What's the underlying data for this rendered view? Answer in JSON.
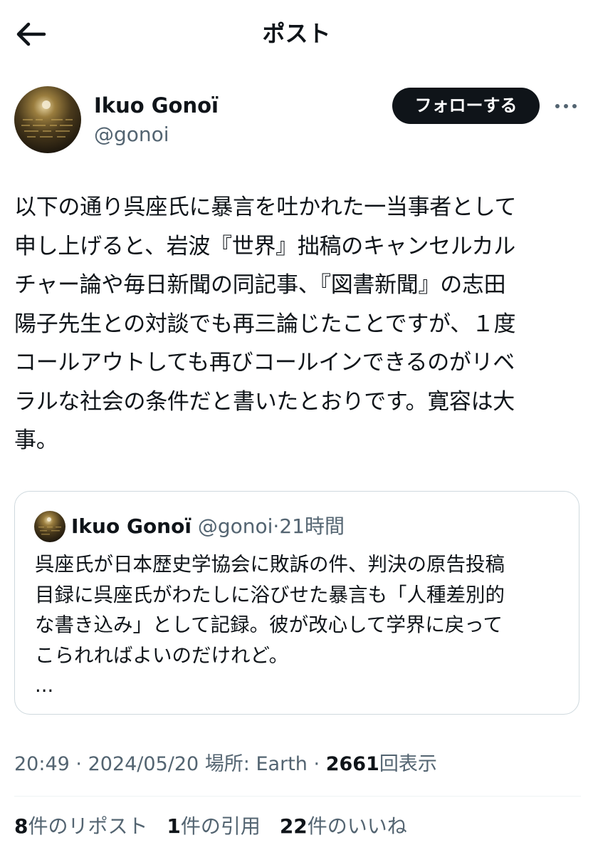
{
  "header": {
    "title": "ポスト",
    "back_icon": "arrow-left-icon"
  },
  "author": {
    "display_name": "Ikuo Gonoï",
    "handle": "@gonoi",
    "follow_label": "フォローする",
    "more_icon": "more-horizontal-icon"
  },
  "post": {
    "lines": [
      "以下の通り呉座氏に暴言を吐かれた一当事者として",
      "申し上げると、岩波『世界』拙稿のキャンセルカル",
      "チャー論や毎日新聞の同記事、『図書新聞』の志田",
      "陽子先生との対談でも再三論じたことですが、１度",
      "コールアウトしても再びコールインできるのがリベ",
      "ラルな社会の条件だと書いたとおりです。寛容は大",
      "事。"
    ]
  },
  "quote": {
    "display_name": "Ikuo Gonoï",
    "handle": "@gonoi",
    "separator": "·",
    "time": "21時間",
    "lines": [
      "呉座氏が日本歴史学協会に敗訴の件、判決の原告投稿",
      "目録に呉座氏がわたしに浴びせた暴言も「人種差別的",
      "な書き込み」として記録。彼が改心して学界に戻って",
      "こられればよいのだけれど。",
      "..."
    ]
  },
  "meta": {
    "time": "20:49",
    "sep1": "·",
    "date": "2024/05/20",
    "location": "場所: Earth",
    "sep2": "·",
    "views_count": "2661",
    "views_label": "回表示"
  },
  "stats": {
    "reposts_count": "8",
    "reposts_label": "件のリポスト",
    "quotes_count": "1",
    "quotes_label": "件の引用",
    "likes_count": "22",
    "likes_label": "件のいいね"
  },
  "colors": {
    "text": "#0f1419",
    "secondary": "#536471",
    "border": "#cfd9de",
    "button_bg": "#0f1419"
  }
}
